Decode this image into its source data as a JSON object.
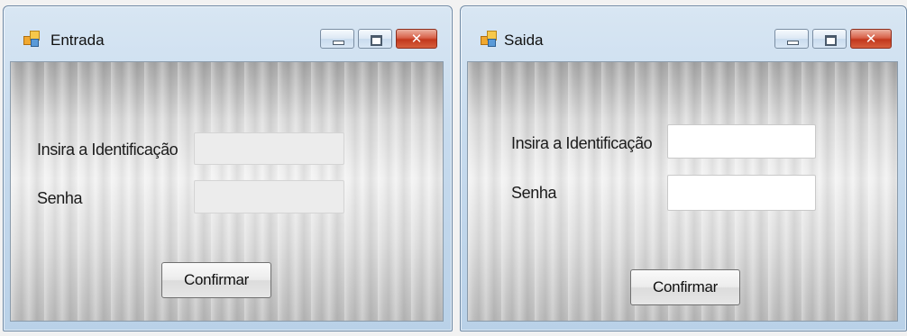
{
  "windows": [
    {
      "title": "Entrada",
      "id_label": "Insira a Identificação",
      "id_value": "",
      "password_label": "Senha",
      "password_value": "",
      "confirm_label": "Confirmar",
      "close_glyph": "✕"
    },
    {
      "title": "Saida",
      "id_label": "Insira a Identificação",
      "id_value": "",
      "password_label": "Senha",
      "password_value": "",
      "confirm_label": "Confirmar",
      "close_glyph": "✕"
    }
  ],
  "icons": {
    "app_icon": "windows-form-icon",
    "minimize": "minimize-icon",
    "maximize": "maximize-icon",
    "close": "close-icon"
  },
  "colors": {
    "title_bar": "#c7dbee",
    "close_button": "#c2381d",
    "form_background": "#e6e6e6"
  }
}
